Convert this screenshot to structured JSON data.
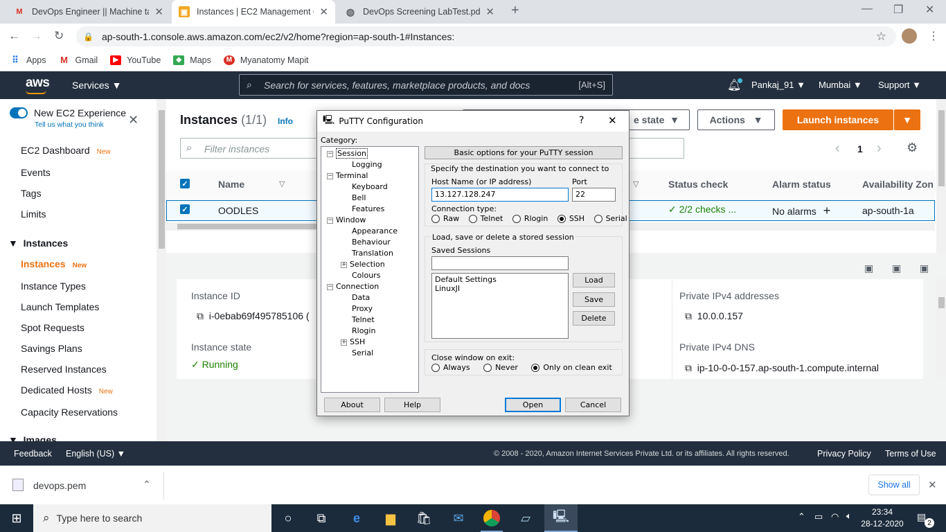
{
  "browser": {
    "tabs": [
      {
        "title": "DevOps Engineer || Machine task",
        "icon": "gmail-icon"
      },
      {
        "title": "Instances | EC2 Management Cor",
        "icon": "aws-icon"
      },
      {
        "title": "DevOps Screening LabTest.pdf",
        "icon": "globe-icon"
      }
    ],
    "url": "ap-south-1.console.aws.amazon.com/ec2/v2/home?region=ap-south-1#Instances:",
    "bookmarks": [
      "Apps",
      "Gmail",
      "YouTube",
      "Maps",
      "Myanatomy Mapit"
    ]
  },
  "aws_header": {
    "logo": "aws",
    "services": "Services",
    "search_placeholder": "Search for services, features, marketplace products, and docs",
    "search_shortcut": "[Alt+S]",
    "user": "Pankaj_91",
    "region": "Mumbai",
    "support": "Support"
  },
  "sidebar": {
    "experience_title": "New EC2 Experience",
    "experience_sub": "Tell us what you think",
    "items": [
      "EC2 Dashboard",
      "Events",
      "Tags",
      "Limits"
    ],
    "new_badge": "New",
    "section": "Instances",
    "section_items": [
      "Instances",
      "Instance Types",
      "Launch Templates",
      "Spot Requests",
      "Savings Plans",
      "Reserved Instances",
      "Dedicated Hosts",
      "Capacity Reservations"
    ],
    "next_section": "Images"
  },
  "main": {
    "title": "Instances",
    "count": "(1/1)",
    "info": "Info",
    "instance_state_btn": "e state",
    "actions_btn": "Actions",
    "launch_btn": "Launch instances",
    "filter_placeholder": "Filter instances",
    "page": "1",
    "columns": [
      "Name",
      "Status check",
      "Alarm status",
      "Availability Zon"
    ],
    "row": {
      "name": "OODLES",
      "status_check": "2/2 checks ...",
      "alarm": "No alarms",
      "az": "ap-south-1a"
    },
    "details": {
      "instance_id_label": "Instance ID",
      "instance_id": "i-0ebab69f495785106 (",
      "instance_state_label": "Instance state",
      "instance_state": "Running",
      "private_ipv4_label": "Private IPv4 addresses",
      "private_ipv4": "10.0.0.157",
      "private_dns_label": "Private IPv4 DNS",
      "private_dns": "ip-10-0-0-157.ap-south-1.compute.internal"
    }
  },
  "footer": {
    "feedback": "Feedback",
    "language": "English (US)",
    "copyright": "© 2008 - 2020, Amazon Internet Services Private Ltd. or its affiliates. All rights reserved.",
    "privacy": "Privacy Policy",
    "terms": "Terms of Use"
  },
  "downloads": {
    "file": "devops.pem",
    "show_all": "Show all"
  },
  "taskbar": {
    "search": "Type here to search",
    "time": "23:34",
    "date": "28-12-2020",
    "notifications": "2"
  },
  "putty": {
    "title": "PuTTY Configuration",
    "help_q": "?",
    "category_label": "Category:",
    "tree": [
      {
        "label": "Session",
        "level": 0,
        "expander": "−"
      },
      {
        "label": "Logging",
        "level": 1
      },
      {
        "label": "Terminal",
        "level": 0,
        "expander": "−"
      },
      {
        "label": "Keyboard",
        "level": 1
      },
      {
        "label": "Bell",
        "level": 1
      },
      {
        "label": "Features",
        "level": 1
      },
      {
        "label": "Window",
        "level": 0,
        "expander": "−"
      },
      {
        "label": "Appearance",
        "level": 1
      },
      {
        "label": "Behaviour",
        "level": 1
      },
      {
        "label": "Translation",
        "level": 1
      },
      {
        "label": "Selection",
        "level": 1,
        "expander": "+"
      },
      {
        "label": "Colours",
        "level": 1
      },
      {
        "label": "Connection",
        "level": 0,
        "expander": "−"
      },
      {
        "label": "Data",
        "level": 1
      },
      {
        "label": "Proxy",
        "level": 1
      },
      {
        "label": "Telnet",
        "level": 1
      },
      {
        "label": "Rlogin",
        "level": 1
      },
      {
        "label": "SSH",
        "level": 1,
        "expander": "+"
      },
      {
        "label": "Serial",
        "level": 1
      }
    ],
    "section_header": "Basic options for your PuTTY session",
    "dest_label": "Specify the destination you want to connect to",
    "host_label": "Host Name (or IP address)",
    "host_value": "13.127.128.247",
    "port_label": "Port",
    "port_value": "22",
    "conn_type_label": "Connection type:",
    "conn_types": [
      "Raw",
      "Telnet",
      "Rlogin",
      "SSH",
      "Serial"
    ],
    "conn_selected": "SSH",
    "sessions_group": "Load, save or delete a stored session",
    "saved_sessions_label": "Saved Sessions",
    "saved_sessions_value": "",
    "sessions": [
      "Default Settings",
      "LinuxJI"
    ],
    "load": "Load",
    "save": "Save",
    "delete": "Delete",
    "close_label": "Close window on exit:",
    "close_options": [
      "Always",
      "Never",
      "Only on clean exit"
    ],
    "close_selected": "Only on clean exit",
    "about": "About",
    "help": "Help",
    "open": "Open",
    "cancel": "Cancel"
  }
}
